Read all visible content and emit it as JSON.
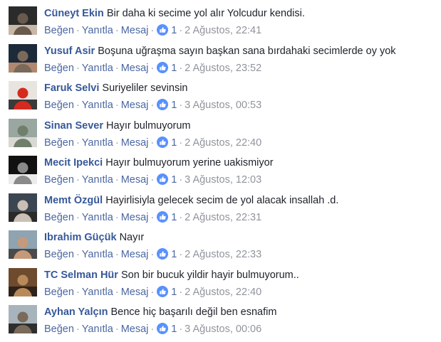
{
  "actions": {
    "like": "Beğen",
    "reply": "Yanıtla",
    "message": "Mesaj",
    "separator": "·"
  },
  "comments": [
    {
      "author": "Cüneyt Ekin",
      "text": "Bir daha ki secime yol alır Yolcudur kendisi.",
      "likes": "1",
      "time": "2 Ağustos, 22:41",
      "avatar_colors": [
        "#2b2b2b",
        "#6a5a4e",
        "#c8b8a8"
      ]
    },
    {
      "author": "Yusuf Asir",
      "text": "Boşuna uğraşma sayın başkan sana bırdahaki secimlerde oy yok",
      "likes": "1",
      "time": "2 Ağustos, 23:52",
      "avatar_colors": [
        "#1d2a3a",
        "#7b6a5a",
        "#b08870"
      ]
    },
    {
      "author": "Faruk Selvi",
      "text": "Suriyeliler sevinsin",
      "likes": "1",
      "time": "3 Ağustos, 00:53",
      "avatar_colors": [
        "#e8e4e0",
        "#d52b1e",
        "#3a3a3a"
      ]
    },
    {
      "author": "Sinan Sever",
      "text": "Hayır bulmuyorum",
      "likes": "1",
      "time": "2 Ağustos, 22:40",
      "avatar_colors": [
        "#9aa7a0",
        "#6f7f6c",
        "#d7d9d2"
      ]
    },
    {
      "author": "Mecit Ipekci",
      "text": "Hayır bulmuyorum yerine uakismiyor",
      "likes": "1",
      "time": "3 Ağustos, 12:03",
      "avatar_colors": [
        "#111111",
        "#8a8a8a",
        "#ececec"
      ]
    },
    {
      "author": "Memt Özgül",
      "text": "Hayirlisiyla gelecek secim de yol alacak insallah .d.",
      "likes": "1",
      "time": "2 Ağustos, 22:31",
      "avatar_colors": [
        "#3c4652",
        "#c9bfb4",
        "#2a2a2a"
      ]
    },
    {
      "author": "Ibrahim Güçük",
      "text": "Nayır",
      "likes": "1",
      "time": "2 Ağustos, 22:33",
      "avatar_colors": [
        "#8fa3b0",
        "#c59a7a",
        "#4a4a4a"
      ]
    },
    {
      "author": "TC Selman Hür",
      "text": "Son bir bucuk yildir hayir bulmuyorum..",
      "likes": "1",
      "time": "2 Ağustos, 22:40",
      "avatar_colors": [
        "#6e4a2e",
        "#b88a5a",
        "#2f2218"
      ]
    },
    {
      "author": "Ayhan Yalçın",
      "text": "Bence hiç başarılı değil ben esnafim",
      "likes": "1",
      "time": "3 Ağustos, 00:06",
      "avatar_colors": [
        "#a8b4bc",
        "#7a6a5a",
        "#2e2e2e"
      ]
    }
  ]
}
